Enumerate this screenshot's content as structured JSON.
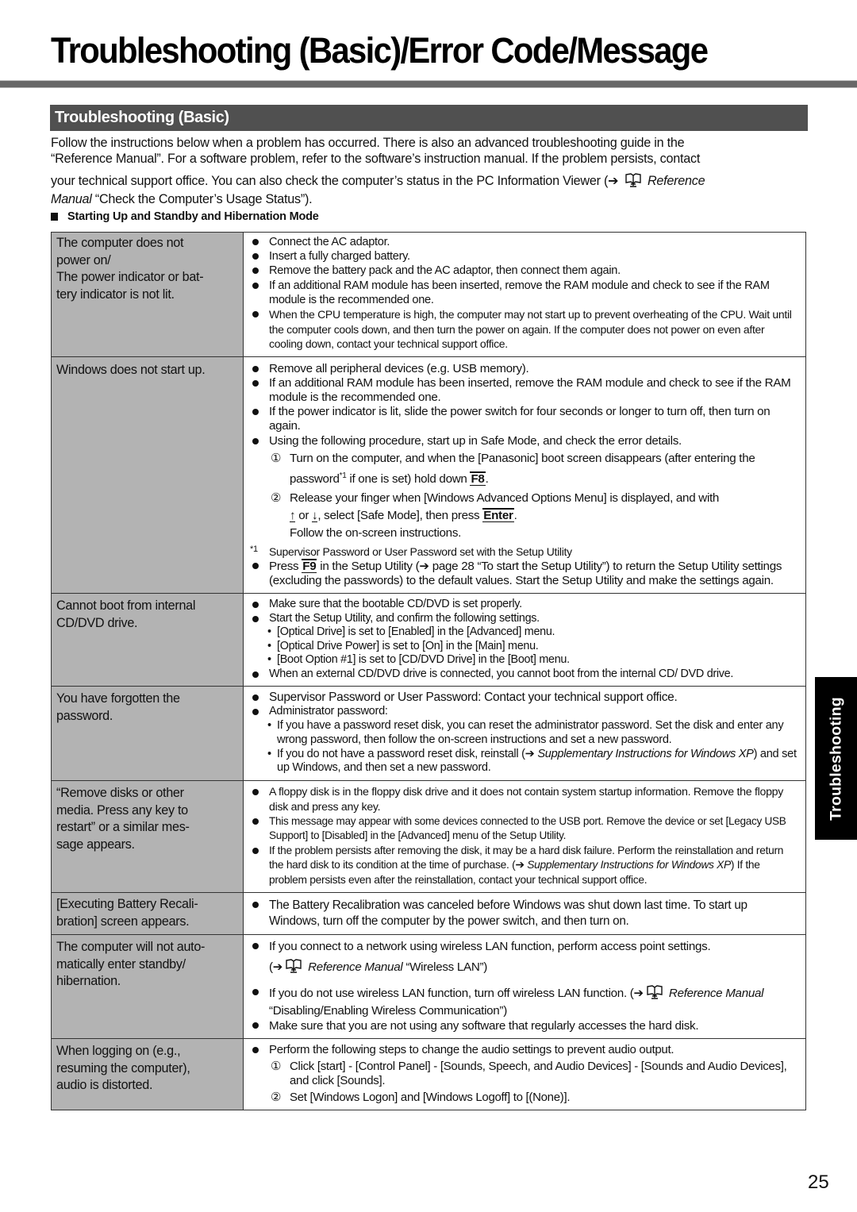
{
  "page_title": "Troubleshooting (Basic)/Error Code/Message",
  "section_title": "Troubleshooting (Basic)",
  "intro": {
    "line1": "Follow the instructions below when a problem has occurred. There is also an advanced troubleshooting guide in the",
    "line2": "“Reference Manual”. For a software problem, refer to the software’s instruction manual. If the problem persists, contact",
    "line3_a": "your technical support office. You can also check the computer’s status in the PC Information Viewer (",
    "line3_ref": "Reference",
    "line4_ref": "Manual",
    "line4_b": " “Check the Computer’s Usage Status”)."
  },
  "subheading": "Starting Up and Standby and Hibernation Mode",
  "arrow": "➔",
  "rows": [
    {
      "symptom": [
        "The computer does not",
        "power on/",
        "The power indicator or bat-",
        "tery indicator is not lit."
      ],
      "bullets": [
        "Connect the AC adaptor.",
        "Insert a fully charged battery.",
        "Remove the battery pack and the AC adaptor, then connect them again.",
        "If an additional RAM module has been inserted, remove the RAM module and check to see if the RAM module is the recommended one.",
        "When the CPU temperature is high, the computer may not start up to prevent overheating of the CPU. Wait until the computer cools down, and then turn the power on again. If the computer does not power on even after cooling down, contact your technical support office."
      ]
    },
    {
      "symptom": [
        "Windows does not start up."
      ],
      "bullets": [
        "Remove all peripheral devices (e.g. USB memory).",
        "If an additional RAM module has been inserted, remove the RAM module and check to see if the RAM module is the recommended one.",
        "If the power indicator is lit, slide the power switch for four seconds or longer to turn off, then turn on again.",
        "Using the following procedure, start up in Safe Mode, and check the error details."
      ],
      "step1_num": "①",
      "step1_a": "Turn on the computer, and when the [Panasonic] boot screen disappears (after entering the password",
      "step1_sup": "*1",
      "step1_b": " if one is set) hold down ",
      "step1_key": "F8",
      "step2_num": "②",
      "step2_a": "Release your finger when [Windows Advanced Options Menu] is displayed, and with",
      "step2_up": "↑",
      "step2_or": " or ",
      "step2_down": "↓",
      "step2_b": ", select [Safe Mode], then press ",
      "step2_key": "Enter",
      "step2_c": "Follow the on-screen instructions.",
      "footnote_mark": "*1",
      "footnote": "Supervisor Password or User Password set with the Setup Utility",
      "last_a": "Press ",
      "last_key": "F9",
      "last_b": " in the Setup Utility (",
      "last_c": " page 28 “To start the Setup Utility”) to return the Setup Utility settings (excluding the passwords) to the default values. Start the Setup Utility and make the settings again."
    },
    {
      "symptom": [
        "Cannot boot from internal",
        "CD/DVD drive."
      ],
      "bullet1": "Make sure that the bootable CD/DVD is set properly.",
      "bullet2": "Start the Setup Utility, and confirm the following settings.",
      "subs": [
        "[Optical Drive] is set to [Enabled] in the [Advanced] menu.",
        "[Optical Drive Power] is set to [On] in the [Main] menu.",
        "[Boot Option #1] is set to [CD/DVD Drive] in the [Boot] menu."
      ],
      "bullet3": "When an external CD/DVD drive is connected, you cannot boot from the internal CD/ DVD drive."
    },
    {
      "symptom": [
        "You have forgotten the",
        "password."
      ],
      "bullet1": "Supervisor Password or User Password: Contact your technical support office.",
      "bullet2": "Administrator password:",
      "sub1": "If you have a password reset disk, you can reset the administrator password. Set the disk and enter any wrong password, then follow the on-screen instructions and set a new password.",
      "sub2_a": "If you do not have a password reset disk, reinstall (",
      "sub2_ref": "Supplementary Instructions for Windows XP",
      "sub2_b": ") and set up Windows, and then set a new password."
    },
    {
      "symptom": [
        "“Remove disks or other",
        "media. Press any key to",
        "restart” or a similar mes-",
        "sage appears."
      ],
      "bullet1": "A floppy disk is in the floppy disk drive and it does not contain system startup information. Remove the floppy disk and press any key.",
      "bullet2": "This message may appear with some devices connected to the USB port. Remove the device or set [Legacy USB Support] to [Disabled] in the [Advanced] menu of the Setup Utility.",
      "bullet3_a": "If the problem persists after removing the disk, it may be a hard disk failure. Perform the reinstallation and return the hard disk to its condition at the time of purchase. (",
      "bullet3_ref": "Supplementary Instructions for Windows XP",
      "bullet3_b": ") If the problem persists even after the reinstallation, contact your technical support office."
    },
    {
      "symptom": [
        "[Executing Battery Recali-",
        "bration] screen appears."
      ],
      "bullet1": "The Battery Recalibration was canceled before Windows was shut down last time. To start up Windows, turn off the computer by the power switch, and then turn on."
    },
    {
      "symptom": [
        "The computer will not auto-",
        "matically enter standby/",
        "hibernation."
      ],
      "bullet1": "If you connect to a network using wireless LAN function, perform access point settings.",
      "bullet1_ref": "Reference Manual",
      "bullet1_ref_b": " “Wireless LAN”)",
      "bullet2_a": "If you do not use wireless LAN function, turn off wireless LAN function. (",
      "bullet2_ref": "Reference Manual",
      "bullet2_b": " “Disabling/Enabling Wireless Communication”)",
      "bullet3": "Make sure that you are not using any software that regularly accesses the hard disk."
    },
    {
      "symptom": [
        "When logging on (e.g.,",
        "resuming the computer),",
        "audio is distorted."
      ],
      "bullet1": "Perform the following steps to change the audio settings to prevent audio output.",
      "step1_num": "①",
      "step1": "Click [start] - [Control Panel] - [Sounds, Speech, and Audio Devices] - [Sounds and Audio Devices], and click [Sounds].",
      "step2_num": "②",
      "step2": "Set [Windows Logon] and [Windows Logoff] to [(None)]."
    }
  ],
  "side_tab": "Troubleshooting",
  "page_number": "25",
  "icons": {
    "reference_manual": "reference-manual-icon",
    "arrow": "arrow-right-icon",
    "bullet": "bullet-icon"
  }
}
